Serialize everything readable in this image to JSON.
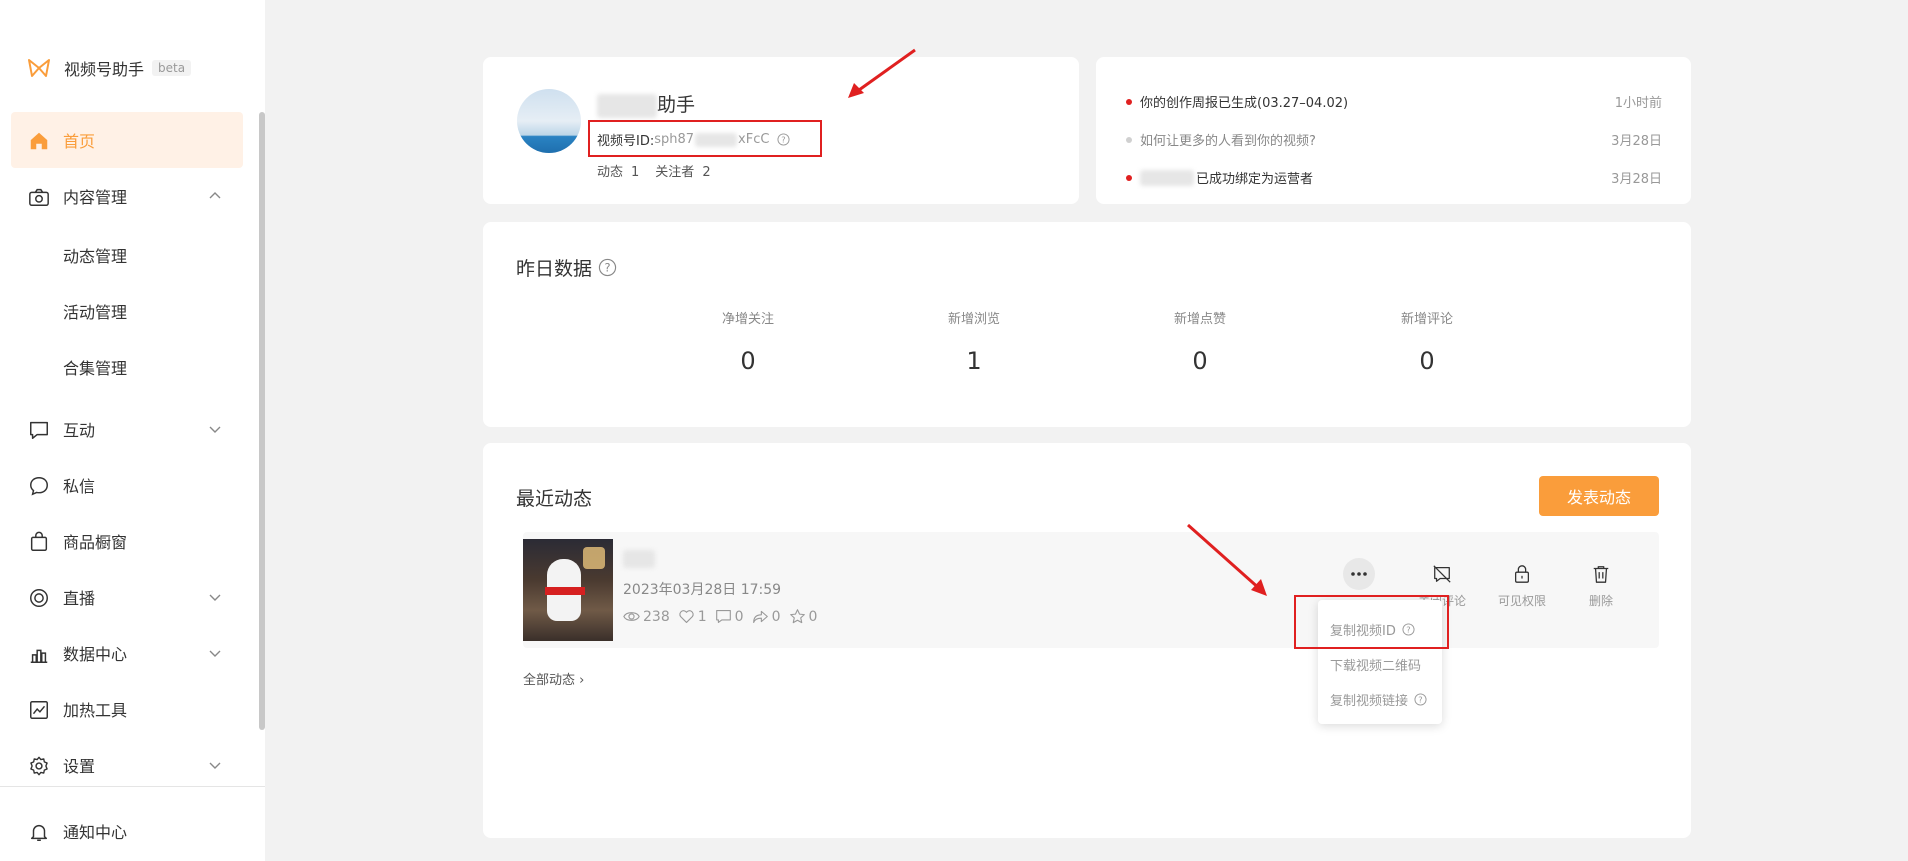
{
  "app": {
    "name": "视频号助手",
    "badge": "beta"
  },
  "sidebar": {
    "items": [
      {
        "label": "首页",
        "icon": "home-icon",
        "active": true
      },
      {
        "label": "内容管理",
        "icon": "camera-icon",
        "expanded": true,
        "children": [
          {
            "label": "动态管理"
          },
          {
            "label": "活动管理"
          },
          {
            "label": "合集管理"
          }
        ]
      },
      {
        "label": "互动",
        "icon": "chat-box-icon"
      },
      {
        "label": "私信",
        "icon": "message-bubble-icon"
      },
      {
        "label": "商品橱窗",
        "icon": "shopping-bag-icon"
      },
      {
        "label": "直播",
        "icon": "live-icon"
      },
      {
        "label": "数据中心",
        "icon": "bar-chart-icon"
      },
      {
        "label": "加热工具",
        "icon": "trend-chart-icon"
      },
      {
        "label": "设置",
        "icon": "gear-icon"
      }
    ],
    "footer": {
      "label": "通知中心",
      "icon": "bell-icon"
    }
  },
  "profile": {
    "name_suffix": "助手",
    "id_label": "视频号ID:",
    "id_prefix": "sph87",
    "id_suffix": "xFcC",
    "stats": [
      {
        "label": "动态",
        "value": "1"
      },
      {
        "label": "关注者",
        "value": "2"
      }
    ]
  },
  "notices": [
    {
      "text": "你的创作周报已生成(03.27–04.02)",
      "time": "1小时前",
      "dot": "red"
    },
    {
      "text": "如何让更多的人看到你的视频?",
      "time": "3月28日",
      "dot": "grey"
    },
    {
      "text": "已成功绑定为运营者",
      "time": "3月28日",
      "dot": "red"
    }
  ],
  "yesterday": {
    "title": "昨日数据",
    "stats": [
      {
        "label": "净增关注",
        "value": "0"
      },
      {
        "label": "新增浏览",
        "value": "1"
      },
      {
        "label": "新增点赞",
        "value": "0"
      },
      {
        "label": "新增评论",
        "value": "0"
      }
    ]
  },
  "recent": {
    "title": "最近动态",
    "publish_label": "发表动态",
    "post": {
      "time": "2023年03月28日 17:59",
      "views": "238",
      "likes": "1",
      "comments": "0",
      "shares": "0",
      "favorites": "0"
    },
    "actions": [
      {
        "label": "关闭评论",
        "icon": "comment-off-icon"
      },
      {
        "label": "可见权限",
        "icon": "lock-icon"
      },
      {
        "label": "删除",
        "icon": "trash-icon"
      }
    ],
    "all_link": "全部动态 ›",
    "menu": [
      {
        "label": "复制视频ID"
      },
      {
        "label": "下载视频二维码"
      },
      {
        "label": "复制视频链接"
      }
    ]
  },
  "colors": {
    "accent": "#fa9d3b",
    "annotation": "#e02020",
    "active_bg": "#fff1e6"
  }
}
